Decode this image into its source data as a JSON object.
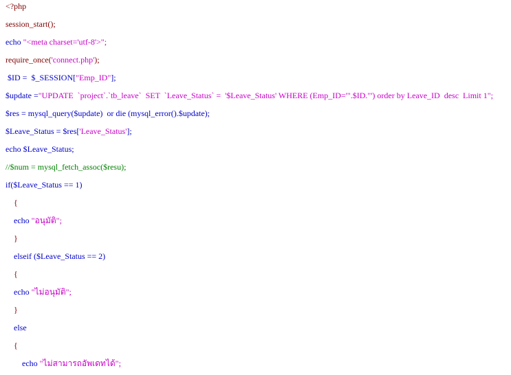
{
  "lines": [
    {
      "parts": [
        {
          "t": "<?php",
          "c": "br"
        }
      ]
    },
    {
      "parts": [
        {
          "t": "session_start();",
          "c": "fn"
        }
      ]
    },
    {
      "parts": [
        {
          "t": "echo ",
          "c": "kw"
        },
        {
          "t": "\"<meta charset='utf-8'>\";",
          "c": "str"
        }
      ]
    },
    {
      "parts": [
        {
          "t": "require_once(",
          "c": "fn"
        },
        {
          "t": "'connect.php'",
          "c": "str"
        },
        {
          "t": ");",
          "c": "fn"
        }
      ]
    },
    {
      "parts": [
        {
          "t": " $ID = ",
          "c": "var"
        },
        {
          "t": " $_SESSION[",
          "c": "var"
        },
        {
          "t": "\"Emp_ID\"",
          "c": "str"
        },
        {
          "t": "];",
          "c": "var"
        }
      ]
    },
    {
      "parts": [
        {
          "t": "$update =",
          "c": "var"
        },
        {
          "t": "\"UPDATE  `project`.`tb_leave`  SET  `Leave_Status` =  '$Leave_Status' WHERE (Emp_ID='\".$ID.\"') order by Leave_ID  desc  Limit 1\";",
          "c": "str"
        }
      ]
    },
    {
      "parts": [
        {
          "t": "$res = mysql_query($update)  or die (mysql_error().$update);",
          "c": "var"
        }
      ]
    },
    {
      "parts": [
        {
          "t": "$Leave_Status = $res[",
          "c": "var"
        },
        {
          "t": "'Leave_Status'",
          "c": "str"
        },
        {
          "t": "];",
          "c": "var"
        }
      ]
    },
    {
      "parts": [
        {
          "t": "echo $Leave_Status;",
          "c": "kw"
        }
      ]
    },
    {
      "parts": [
        {
          "t": "//$num = mysql_fetch_assoc($resu);",
          "c": "cm"
        }
      ]
    },
    {
      "parts": [
        {
          "t": "if($Leave_Status == 1)",
          "c": "kw"
        }
      ]
    },
    {
      "parts": [
        {
          "t": "    {",
          "c": "br"
        }
      ]
    },
    {
      "parts": [
        {
          "t": "    echo ",
          "c": "kw"
        },
        {
          "t": "\"อนุมัติ\";",
          "c": "str"
        }
      ]
    },
    {
      "parts": [
        {
          "t": "    }",
          "c": "br"
        }
      ]
    },
    {
      "parts": [
        {
          "t": "    elseif ($Leave_Status == 2)",
          "c": "kw"
        }
      ]
    },
    {
      "parts": [
        {
          "t": "    {",
          "c": "br"
        }
      ]
    },
    {
      "parts": [
        {
          "t": "    echo ",
          "c": "kw"
        },
        {
          "t": "\"ไม่อนุมัติ\";",
          "c": "str"
        }
      ]
    },
    {
      "parts": [
        {
          "t": "    }",
          "c": "br"
        }
      ]
    },
    {
      "parts": [
        {
          "t": "    else",
          "c": "kw"
        }
      ]
    },
    {
      "parts": [
        {
          "t": "    {",
          "c": "br"
        }
      ]
    },
    {
      "parts": [
        {
          "t": "        echo ",
          "c": "kw"
        },
        {
          "t": "\"ไม่สามารถอัพเดทได้\";",
          "c": "str"
        }
      ]
    }
  ]
}
